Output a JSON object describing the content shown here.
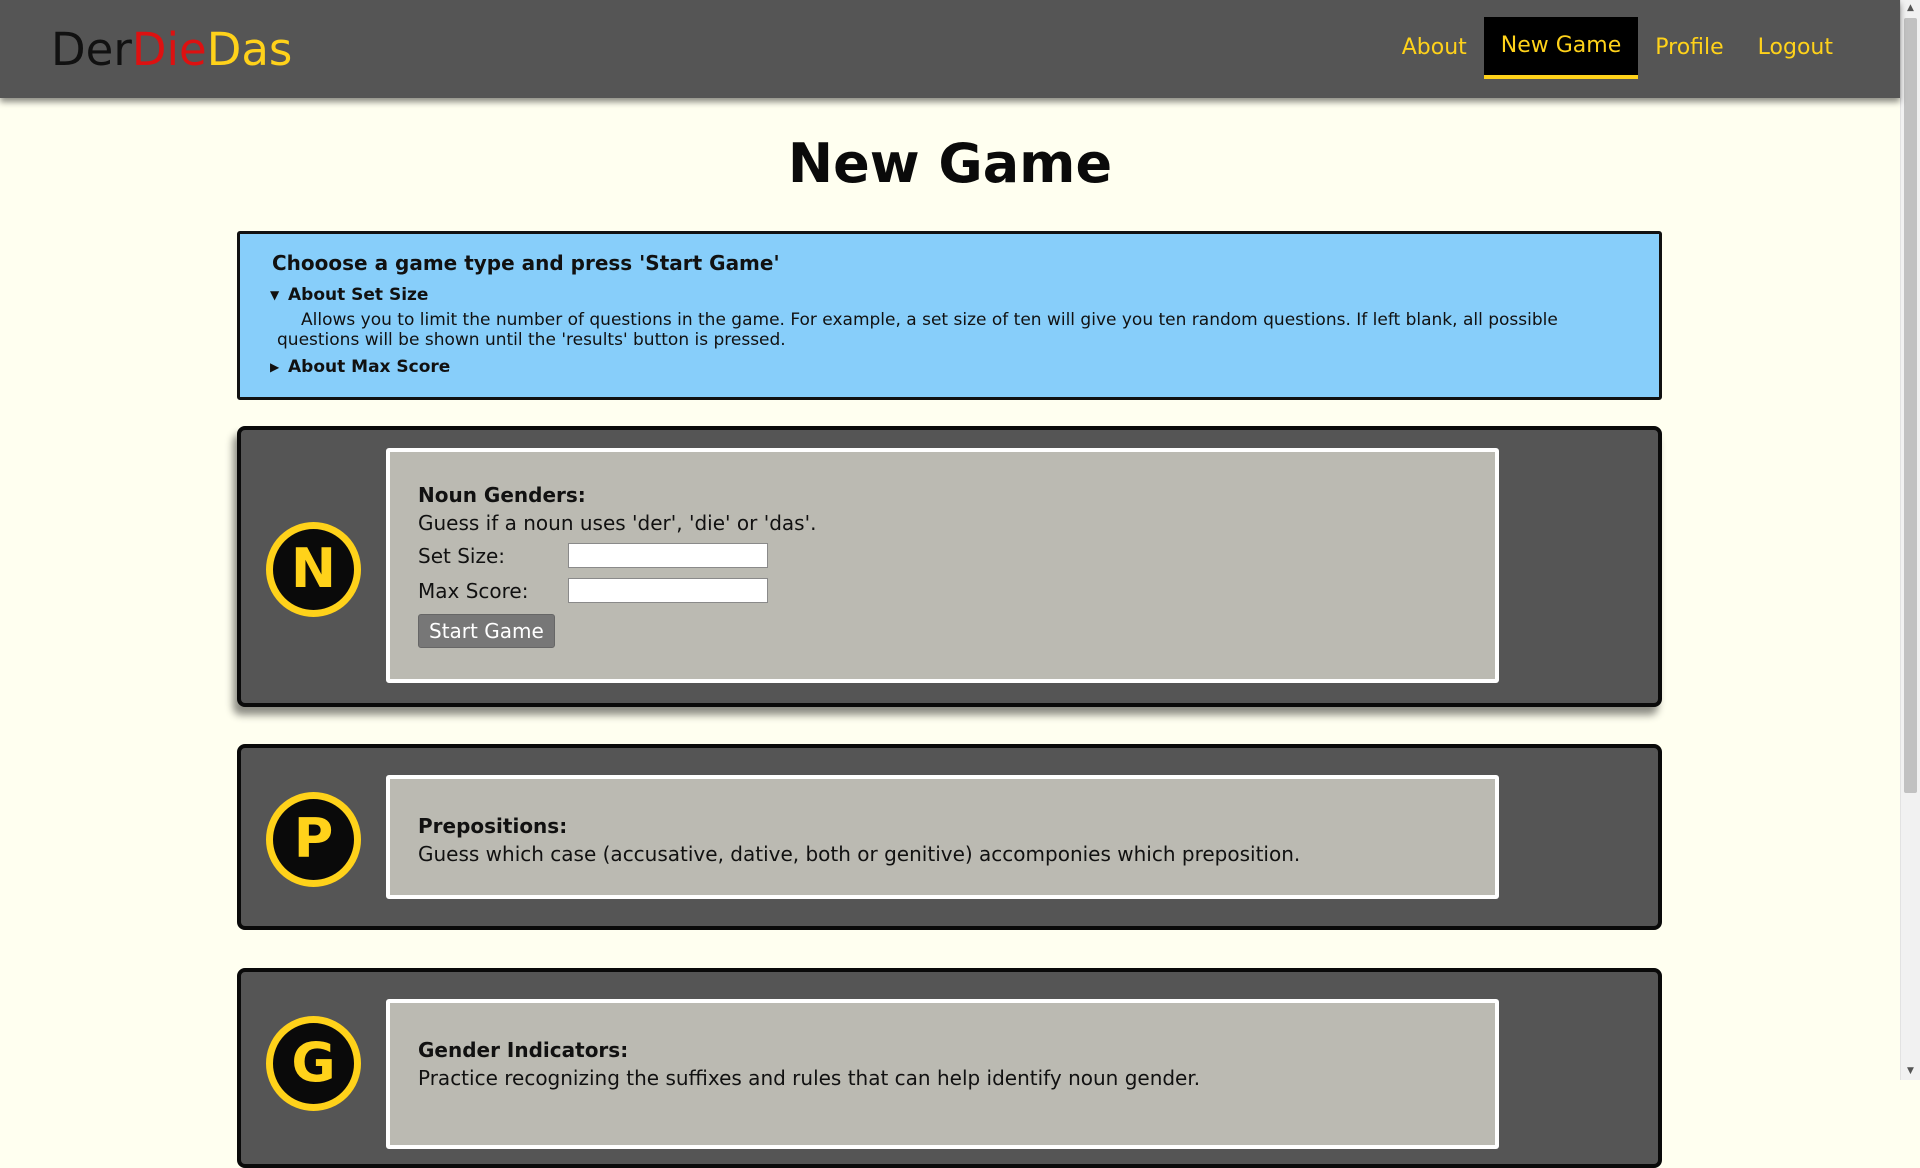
{
  "logo": {
    "der": "Der",
    "die": "Die",
    "das": "Das"
  },
  "nav": {
    "items": [
      {
        "label": "About",
        "active": false
      },
      {
        "label": "New Game",
        "active": true
      },
      {
        "label": "Profile",
        "active": false
      },
      {
        "label": "Logout",
        "active": false
      }
    ]
  },
  "page": {
    "title": "New Game"
  },
  "info": {
    "heading": "Chooose a game type and press 'Start Game'",
    "set_size": {
      "summary": "About Set Size",
      "expanded": true,
      "body": "Allows you to limit the number of questions in the game. For example, a set size of ten will give you ten random questions. If left blank, all possible questions will be shown until the 'results' button is pressed."
    },
    "max_score": {
      "summary": "About Max Score",
      "expanded": false
    }
  },
  "games": [
    {
      "letter": "N",
      "title": "Noun Genders:",
      "description": "Guess if a noun uses 'der', 'die' or 'das'.",
      "set_size_label": "Set Size:",
      "set_size_value": "",
      "max_score_label": "Max Score:",
      "max_score_value": "",
      "start_label": "Start Game"
    },
    {
      "letter": "P",
      "title": "Prepositions:",
      "description": "Guess which case (accusative, dative, both or genitive) accomponies which preposition."
    },
    {
      "letter": "G",
      "title": "Gender Indicators:",
      "description": "Practice recognizing the suffixes and rules that can help identify noun gender."
    }
  ],
  "colors": {
    "navbar": "#555555",
    "accent": "#ffd21a",
    "info_bg": "#87cefa",
    "card_bg": "#555555",
    "inner_bg": "#bbbab2",
    "page_bg": "#fffff0"
  },
  "icons": {
    "expanded": "triangle-down-icon",
    "collapsed": "triangle-right-icon"
  }
}
